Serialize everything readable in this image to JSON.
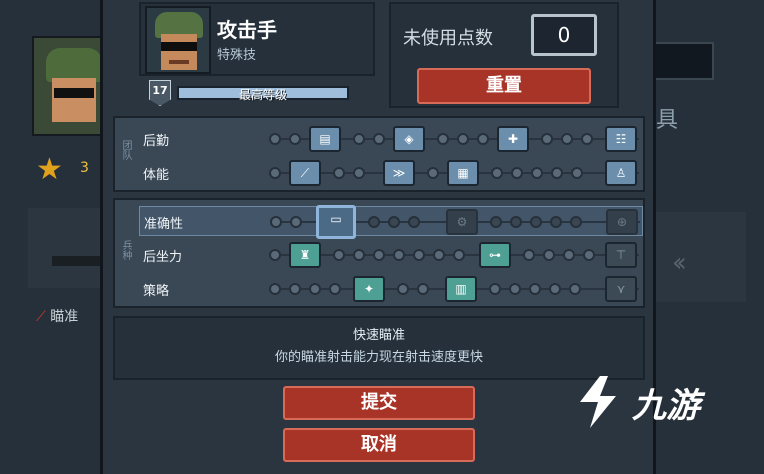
{
  "background": {
    "left_star_count": "3",
    "left_aim_label": "瞄准",
    "right_label": "具"
  },
  "header": {
    "class_title": "攻击手",
    "class_subtitle": "特殊技",
    "level": "17",
    "level_text": "最高等级",
    "level_progress": 1.0
  },
  "points": {
    "label": "未使用点数",
    "value": "0",
    "reset_label": "重置"
  },
  "panels": {
    "top_tag": "团队",
    "bottom_tag": "兵种",
    "rows": [
      {
        "label": "后勤"
      },
      {
        "label": "体能"
      },
      {
        "label": "准确性"
      },
      {
        "label": "后坐力"
      },
      {
        "label": "策略"
      }
    ]
  },
  "description": {
    "title": "快速瞄准",
    "text": "你的瞄准射击能力现在射击速度更快"
  },
  "buttons": {
    "submit": "提交",
    "cancel": "取消"
  },
  "watermark": {
    "text": "九游"
  },
  "colors": {
    "accent_red": "#a83428",
    "node_blue": "#6a8eac",
    "node_teal": "#4ea094"
  }
}
